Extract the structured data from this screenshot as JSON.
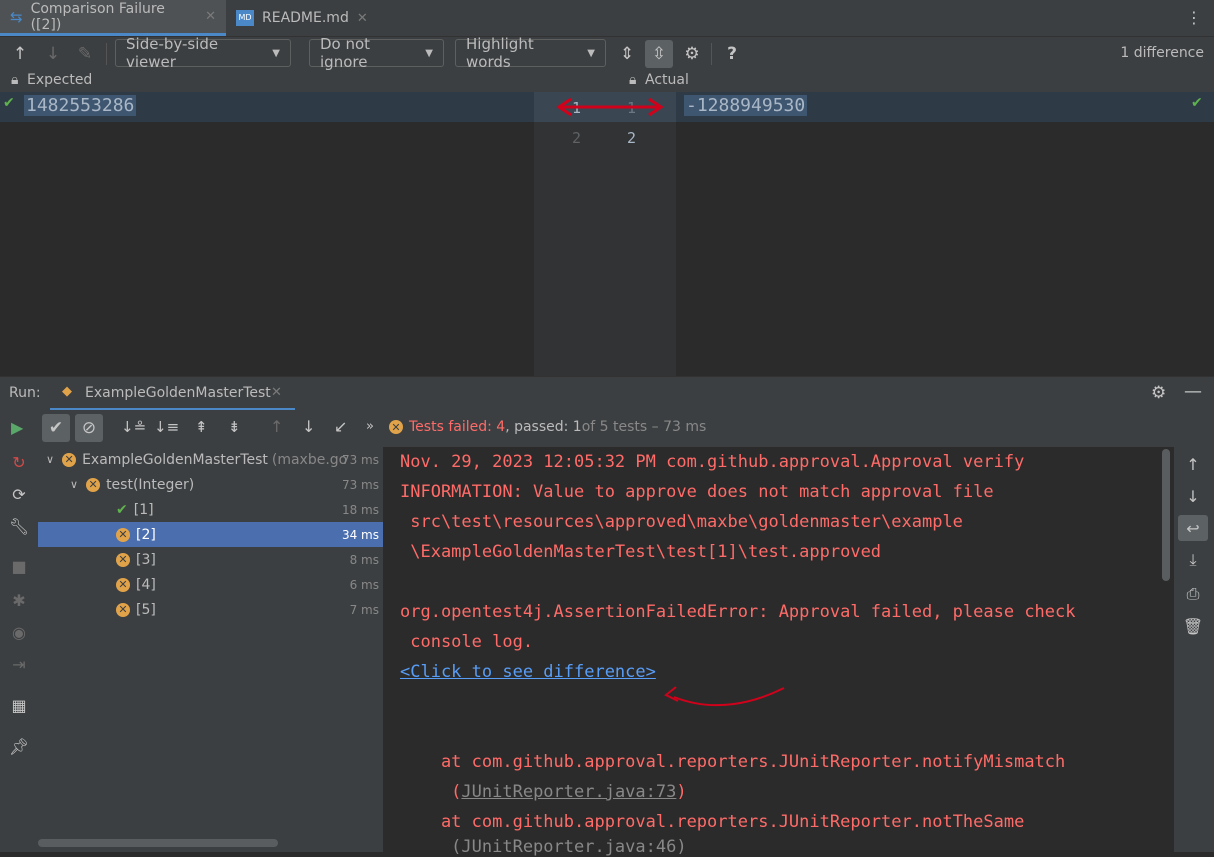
{
  "tabs": [
    {
      "label": "Comparison Failure ([2])",
      "icon": "diff-icon"
    },
    {
      "label": "README.md",
      "icon": "markdown-file-icon"
    }
  ],
  "diff_toolbar": {
    "viewer": "Side-by-side viewer",
    "ignore": "Do not ignore",
    "highlight": "Highlight words",
    "help": "?",
    "summary": "1 difference"
  },
  "diff": {
    "left_label": "Expected",
    "right_label": "Actual",
    "left_line1": "1482553286",
    "right_line1": "-1288949530",
    "gutter_left": [
      "1",
      "2"
    ],
    "gutter_right": [
      "1",
      "2"
    ]
  },
  "run": {
    "label": "Run:",
    "config": "ExampleGoldenMasterTest",
    "status_failed": "Tests failed: 4",
    "status_rest": ", passed: 1",
    "status_total": " of 5 tests – 73 ms"
  },
  "tree": [
    {
      "label": "ExampleGoldenMasterTest",
      "suffix": "(maxbe.go",
      "time": "73 ms"
    },
    {
      "label": "test(Integer)",
      "time": "73 ms"
    },
    {
      "label": "[1]",
      "time": "18 ms"
    },
    {
      "label": "[2]",
      "time": "34 ms"
    },
    {
      "label": "[3]",
      "time": "8 ms"
    },
    {
      "label": "[4]",
      "time": "6 ms"
    },
    {
      "label": "[5]",
      "time": "7 ms"
    }
  ],
  "console": {
    "line1": "Nov. 29, 2023 12:05:32 PM com.github.approval.Approval verify",
    "line2": "INFORMATION: Value to approve does not match approval file",
    "line3": " src\\test\\resources\\approved\\maxbe\\goldenmaster\\example",
    "line4": " \\ExampleGoldenMasterTest\\test[1]\\test.approved",
    "line5": "org.opentest4j.AssertionFailedError: Approval failed, please check",
    "line6": " console log.",
    "link": "<Click to see difference>",
    "line8": "    at com.github.approval.reporters.JUnitReporter.notifyMismatch",
    "line9a": "     (",
    "line9link": "JUnitReporter.java:73",
    "line9b": ")",
    "line10": "    at com.github.approval.reporters.JUnitReporter.notTheSame",
    "line11": "     (JUnitReporter.java:46)"
  },
  "colors": {
    "error": "#ff6b68",
    "link": "#589df6",
    "selection": "#4b6eaf",
    "annotation": "#d0021b"
  }
}
